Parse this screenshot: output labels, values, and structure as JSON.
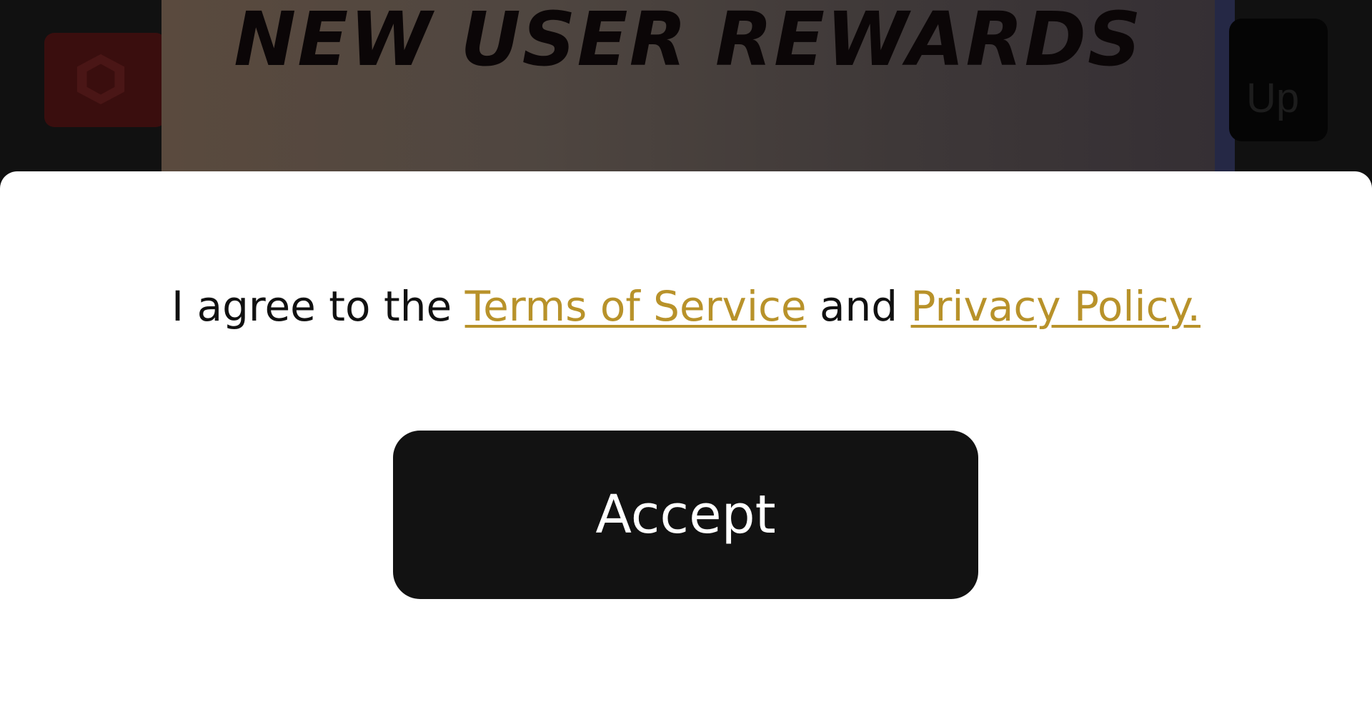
{
  "background": {
    "banner_title": "NEW USER REWARDS",
    "right_button_label": "Up",
    "left_logo_icon": "brand-logo-icon"
  },
  "consent": {
    "prefix": "I agree to the",
    "terms_link": "Terms of Service",
    "conjunction": "and",
    "privacy_link": "Privacy Policy.",
    "accept_label": "Accept"
  },
  "colors": {
    "link": "#b8922a",
    "button_bg": "#121212",
    "sheet_bg": "#ffffff"
  }
}
